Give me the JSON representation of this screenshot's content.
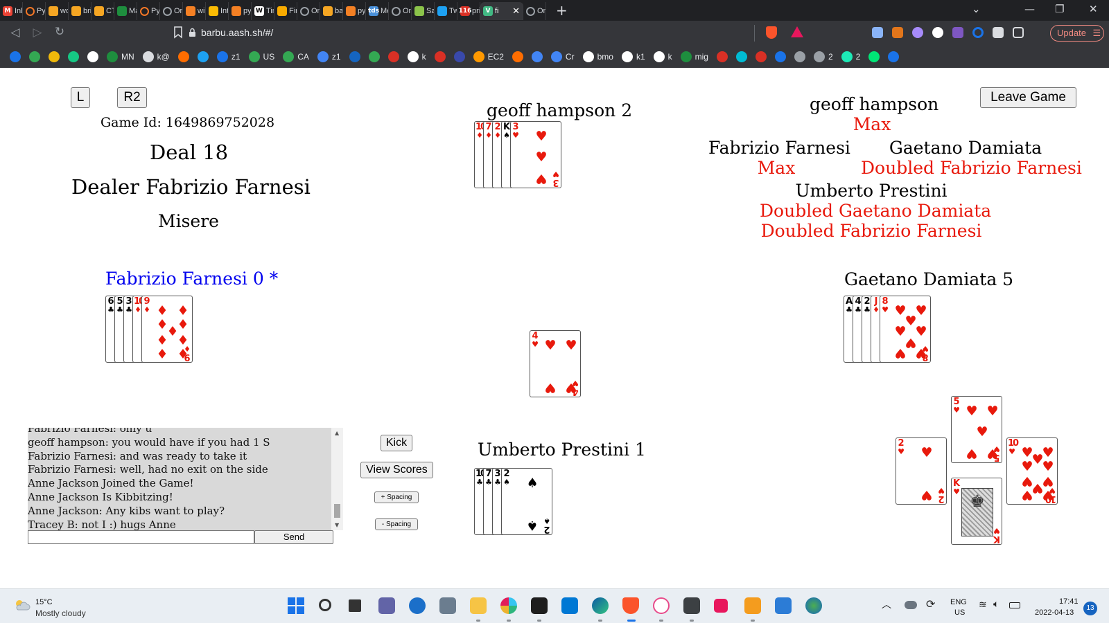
{
  "browser": {
    "tabs": [
      {
        "title": "Inbo",
        "icon": "gmail-icon",
        "color": "#ea4335"
      },
      {
        "title": "Pyth",
        "icon": "jupyter-icon",
        "color": "#f37726"
      },
      {
        "title": "word",
        "icon": "blogger-icon",
        "color": "#f5a623"
      },
      {
        "title": "brillia",
        "icon": "blogger-icon",
        "color": "#f5a623"
      },
      {
        "title": "CTI_C",
        "icon": "blogger-icon",
        "color": "#f5a623"
      },
      {
        "title": "Mark",
        "icon": "plus-icon",
        "color": "#1e8e3e"
      },
      {
        "title": "Pyth",
        "icon": "jupyter-icon",
        "color": "#f37726"
      },
      {
        "title": "Onlir",
        "icon": "globe-icon",
        "color": "#9aa0a6"
      },
      {
        "title": "wina",
        "icon": "stackoverflow-icon",
        "color": "#f48024"
      },
      {
        "title": "Intro",
        "icon": "note-icon",
        "color": "#fbbc04"
      },
      {
        "title": "pyth",
        "icon": "stackoverflow-icon",
        "color": "#f48024"
      },
      {
        "title": "Time",
        "icon": "wikipedia-icon",
        "color": "#ffffff"
      },
      {
        "title": "Find",
        "icon": "sun-icon",
        "color": "#f9ab00"
      },
      {
        "title": "Onlir",
        "icon": "globe-icon",
        "color": "#9aa0a6"
      },
      {
        "title": "barb",
        "icon": "blogger-icon",
        "color": "#f5a623"
      },
      {
        "title": "pyth",
        "icon": "stackoverflow-icon",
        "color": "#f48024"
      },
      {
        "title": "Mea",
        "icon": "tds-icon",
        "color": "#4a90d9"
      },
      {
        "title": "Onlir",
        "icon": "globe-icon",
        "color": "#9aa0a6"
      },
      {
        "title": "Sam",
        "icon": "smile-icon",
        "color": "#8bc34a"
      },
      {
        "title": "Twitt",
        "icon": "twitter-icon",
        "color": "#1da1f2"
      },
      {
        "title": "price",
        "icon": "badge-116-icon",
        "color": "#d93025"
      },
      {
        "title": "fi",
        "icon": "vue-icon",
        "color": "#41b883",
        "active": true
      },
      {
        "title": "Onlir",
        "icon": "globe-icon",
        "color": "#9aa0a6"
      }
    ],
    "url": "barbu.aash.sh/#/",
    "update_label": "Update",
    "bookmarks": [
      {
        "label": "",
        "color": "#1a73e8"
      },
      {
        "label": "",
        "color": "#34a853"
      },
      {
        "label": "",
        "color": "#f0b90b"
      },
      {
        "label": "",
        "color": "#16c784"
      },
      {
        "label": "",
        "color": "#ffffff"
      },
      {
        "label": "MN",
        "color": "#1e8e3e"
      },
      {
        "label": "k@",
        "color": "#dadce0"
      },
      {
        "label": "",
        "color": "#ff6d00"
      },
      {
        "label": "",
        "color": "#1da1f2"
      },
      {
        "label": "z1",
        "color": "#1a73e8"
      },
      {
        "label": "US",
        "color": "#34a853"
      },
      {
        "label": "CA",
        "color": "#34a853"
      },
      {
        "label": "z1",
        "color": "#4285f4"
      },
      {
        "label": "",
        "color": "#1565c0"
      },
      {
        "label": "",
        "color": "#34a853"
      },
      {
        "label": "",
        "color": "#d93025"
      },
      {
        "label": "k",
        "color": "#ffffff"
      },
      {
        "label": "",
        "color": "#d93025"
      },
      {
        "label": "",
        "color": "#3949ab"
      },
      {
        "label": "EC2",
        "color": "#ff9900"
      },
      {
        "label": "",
        "color": "#ff6d00"
      },
      {
        "label": "",
        "color": "#4285f4"
      },
      {
        "label": "Cr",
        "color": "#4285f4"
      },
      {
        "label": "bmo",
        "color": "#ffffff"
      },
      {
        "label": "k1",
        "color": "#ffffff"
      },
      {
        "label": "k",
        "color": "#ffffff"
      },
      {
        "label": "mig",
        "color": "#1e8e3e"
      },
      {
        "label": "",
        "color": "#d93025"
      },
      {
        "label": "",
        "color": "#00bcd4"
      },
      {
        "label": "",
        "color": "#d93025"
      },
      {
        "label": "",
        "color": "#1a73e8"
      },
      {
        "label": "",
        "color": "#9aa0a6"
      },
      {
        "label": "2",
        "color": "#9aa0a6"
      },
      {
        "label": "2",
        "color": "#1de9b6"
      },
      {
        "label": "",
        "color": "#00e676"
      },
      {
        "label": "",
        "color": "#1a73e8"
      }
    ]
  },
  "game": {
    "left_button": "L",
    "r2_button": "R2",
    "leave_button": "Leave Game",
    "game_id": "Game Id: 1649869752028",
    "deal": "Deal 18",
    "dealer": "Dealer Fabrizio Farnesi",
    "contract": "Misere",
    "players": {
      "top": "geoff hampson 2",
      "left": "Fabrizio Farnesi 0 *",
      "right": "Gaetano Damiata 5",
      "bottom": "Umberto Prestini 1"
    },
    "bids": {
      "top": {
        "name": "geoff hampson",
        "lines": [
          "Max"
        ]
      },
      "left": {
        "name": "Fabrizio Farnesi",
        "lines": [
          "Max"
        ]
      },
      "right": {
        "name": "Gaetano Damiata",
        "lines": [
          "Doubled Fabrizio Farnesi"
        ]
      },
      "bottom": {
        "name": "Umberto Prestini",
        "lines": [
          "Doubled Gaetano Damiata",
          "Doubled Fabrizio Farnesi"
        ]
      }
    },
    "hands": {
      "top": [
        {
          "rank": "10",
          "suit": "♦"
        },
        {
          "rank": "7",
          "suit": "♦"
        },
        {
          "rank": "2",
          "suit": "♦"
        },
        {
          "rank": "K",
          "suit": "♠"
        },
        {
          "rank": "3",
          "suit": "♥"
        }
      ],
      "left": [
        {
          "rank": "6",
          "suit": "♣"
        },
        {
          "rank": "5",
          "suit": "♣"
        },
        {
          "rank": "3",
          "suit": "♣"
        },
        {
          "rank": "10",
          "suit": "♦"
        },
        {
          "rank": "9",
          "suit": "♦"
        }
      ],
      "right": [
        {
          "rank": "A",
          "suit": "♣"
        },
        {
          "rank": "4",
          "suit": "♣"
        },
        {
          "rank": "2",
          "suit": "♣"
        },
        {
          "rank": "J",
          "suit": "♦"
        },
        {
          "rank": "8",
          "suit": "♥"
        }
      ],
      "bottom": [
        {
          "rank": "10",
          "suit": "♣"
        },
        {
          "rank": "7",
          "suit": "♣"
        },
        {
          "rank": "3",
          "suit": "♣"
        },
        {
          "rank": "2",
          "suit": "♠"
        }
      ]
    },
    "center_card": {
      "rank": "4",
      "suit": "♥"
    },
    "last_trick": {
      "top": {
        "rank": "5",
        "suit": "♥"
      },
      "left": {
        "rank": "2",
        "suit": "♥"
      },
      "right": {
        "rank": "10",
        "suit": "♥"
      },
      "bottom": {
        "rank": "K",
        "suit": "♥"
      }
    },
    "chat": [
      "Fabrizio Farnesi: only u",
      "geoff hampson: you would have if you had 1 S",
      "Fabrizio Farnesi: and was ready to take it",
      "Fabrizio Farnesi: well, had no exit on the side",
      "Anne Jackson Joined the Game!",
      "Anne Jackson Is Kibbitzing!",
      "Anne Jackson: Any kibs want to play?",
      "Tracey B: not I :) hugs Anne"
    ],
    "chat_input_value": "",
    "send_button": "Send",
    "kick_button": "Kick",
    "scores_button": "View Scores",
    "plus_spacing_button": "+ Spacing",
    "minus_spacing_button": "- Spacing"
  },
  "taskbar": {
    "weather_temp": "15°C",
    "weather_desc": "Mostly cloudy",
    "lang_line1": "ENG",
    "lang_line2": "US",
    "time": "17:41",
    "date": "2022-04-13",
    "notifications": "13"
  }
}
